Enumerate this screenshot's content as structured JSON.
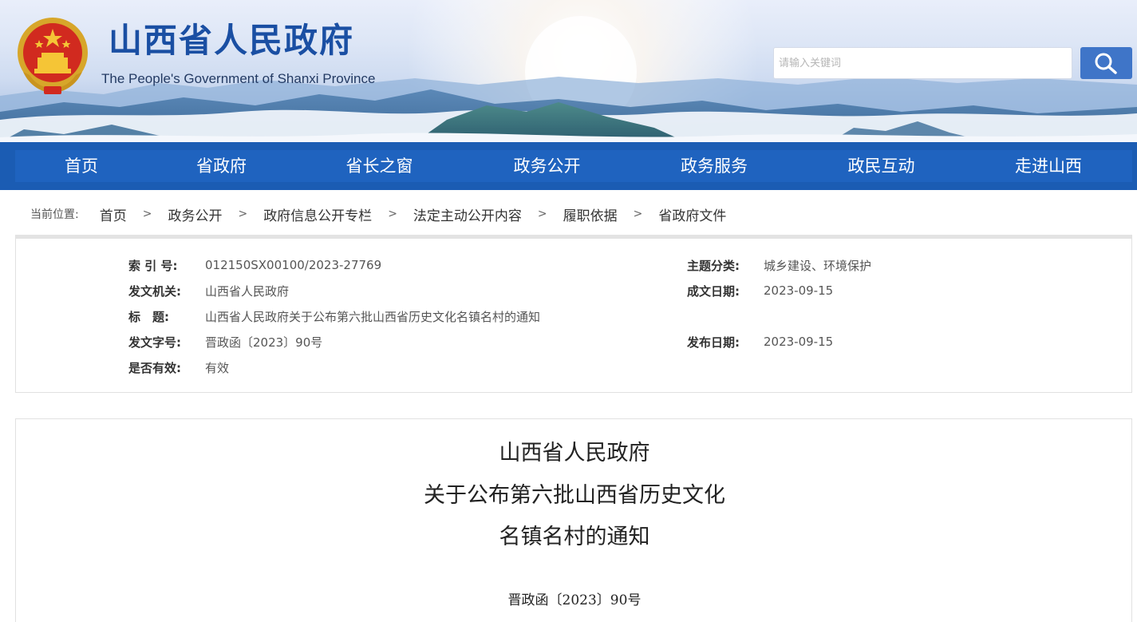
{
  "header": {
    "site_title": "山西省人民政府",
    "site_subtitle": "The People's Government of Shanxi Province",
    "search_placeholder": "请输入关键词",
    "emblem_icon": "national-emblem-icon",
    "search_icon": "search-icon",
    "brand_color": "#1a4fa3"
  },
  "nav": {
    "items": [
      {
        "label": "首页"
      },
      {
        "label": "省政府"
      },
      {
        "label": "省长之窗"
      },
      {
        "label": "政务公开"
      },
      {
        "label": "政务服务"
      },
      {
        "label": "政民互动"
      },
      {
        "label": "走进山西"
      }
    ],
    "bar_color": "#1b5cb3"
  },
  "breadcrumb": {
    "label": "当前位置:",
    "items": [
      "首页",
      "政务公开",
      "政府信息公开专栏",
      "法定主动公开内容",
      "履职依据",
      "省政府文件"
    ],
    "separator": ">"
  },
  "meta": {
    "index_no": {
      "key": "索 引 号:",
      "value": "012150SX00100/2023-27769"
    },
    "topic": {
      "key": "主题分类:",
      "value": "城乡建设、环境保护"
    },
    "issuer": {
      "key": "发文机关:",
      "value": "山西省人民政府"
    },
    "created_date": {
      "key": "成文日期:",
      "value": "2023-09-15"
    },
    "title": {
      "key": "标　题:",
      "value": "山西省人民政府关于公布第六批山西省历史文化名镇名村的通知"
    },
    "doc_no": {
      "key": "发文字号:",
      "value": "晋政函〔2023〕90号"
    },
    "publish_date": {
      "key": "发布日期:",
      "value": "2023-09-15"
    },
    "validity": {
      "key": "是否有效:",
      "value": "有效"
    }
  },
  "article": {
    "title_lines": [
      "山西省人民政府",
      "关于公布第六批山西省历史文化",
      "名镇名村的通知"
    ],
    "doc_number": "晋政函〔2023〕90号"
  }
}
